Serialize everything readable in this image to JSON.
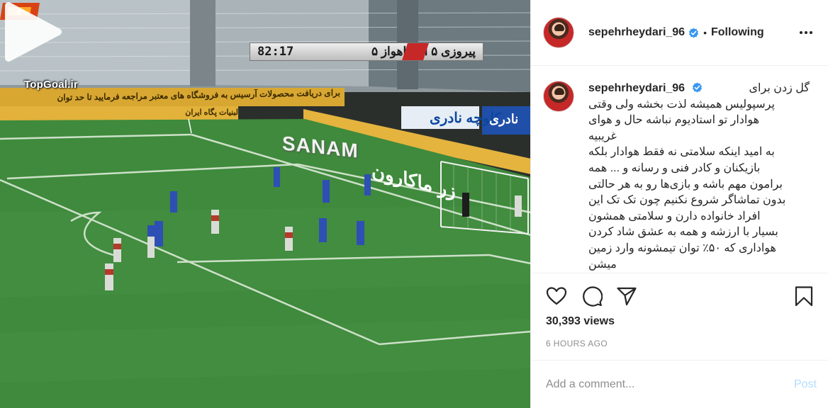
{
  "video": {
    "watermark": "TopGoal.ir",
    "scoreboard": {
      "time": "82:17",
      "text": "پیروزی ۵  اس.اهواز ۵"
    },
    "ads": {
      "sanam": "SANAM",
      "zar": "زر ماکارون",
      "golchin": "کلوچه نادری",
      "nadery": "نادری",
      "banner_top": "برای دریافت محصولات آرسیس به فروشگاه های معتبر مراجعه فرمایید تا حد توان",
      "banner_bottom": "لبنیات پگاه ایران"
    },
    "play_icon": "play-icon"
  },
  "header": {
    "username": "sepehrheydari_96",
    "verified_icon": "verified-badge-icon",
    "separator": "•",
    "follow_status": "Following",
    "more_icon": "more-options-icon"
  },
  "caption": {
    "username": "sepehrheydari_96",
    "first_line": "گل زدن برای",
    "lines": [
      "پرسپولیس همیشه لذت بخشه ولی وقتی",
      "هوادار تو استادیوم نباشه حال و هوای",
      "غریبیه",
      "به امید اینکه سلامتی نه فقط هوادار بلکه",
      "بازیکنان و کادر فنی و رسانه و ... همه",
      "برامون مهم باشه و بازی‌ها رو به هر حالتی",
      "بدون تماشاگر شروع نکنیم چون تک تک این",
      "افراد خانواده دارن و سلامتی همشون",
      "بسیار با ارزشه و همه به عشق شاد کردن",
      "هواداری که ۵۰٪ توان تیمشونه وارد زمین",
      "میشن"
    ]
  },
  "actions": {
    "like_icon": "heart-icon",
    "comment_icon": "comment-icon",
    "share_icon": "share-icon",
    "save_icon": "bookmark-icon"
  },
  "stats": {
    "views": "30,393 views",
    "time_ago": "6 HOURS AGO"
  },
  "comment": {
    "placeholder": "Add a comment...",
    "post_label": "Post"
  },
  "colors": {
    "pitch": "#3f8a3c",
    "verified": "#3897f0",
    "post_disabled": "#b3dbff",
    "muted_text": "#8e8e8e"
  }
}
